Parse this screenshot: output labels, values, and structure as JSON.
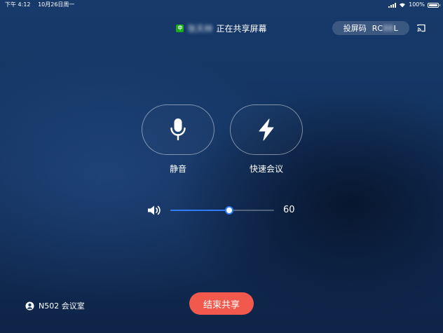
{
  "status_bar": {
    "time": "下午 4:12",
    "date": "10月26日周一",
    "battery": "100%"
  },
  "share_banner": {
    "badge": "中",
    "sharer_name": "张天林",
    "text": "正在共享屏幕"
  },
  "cast_code": {
    "label": "投屏码",
    "code_prefix": "RC",
    "code_hidden": "88",
    "code_suffix": "L"
  },
  "controls": {
    "mute_label": "静音",
    "quick_meeting_label": "快速会议"
  },
  "volume": {
    "value": "60",
    "level_percent": 57
  },
  "room": {
    "name": "N502 会议室"
  },
  "end_share_button": "结束共享",
  "colors": {
    "accent": "#2f7cf6",
    "end_button": "#f0594c",
    "wechat_green": "#1aad19"
  }
}
